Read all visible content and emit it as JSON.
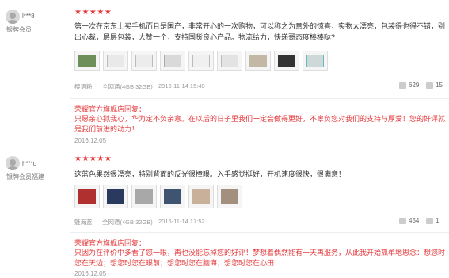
{
  "reviews": [
    {
      "username": "l***8",
      "level": "银牌会员",
      "stars": "★★★★★",
      "content": "第一次在京东上买手机而且是国产，非常开心的一次购物，可以称之为意外的惊喜，实物太漂亮，包装得也得不错，别出心裁，层层包装，大赞一个，支持国货良心产品。物流给力，快递哥态度棒棒哒?",
      "color": "樱语粉",
      "spec": "全网通(4GB 32GB)",
      "datetime": "2016-11-14 15:49",
      "likes": "629",
      "replies": "15",
      "reply_label": "荣耀官方旗舰店回复：",
      "reply_text": "只愿亲心拟我心，华为定不负亲意。在以后的日子里我们一定会做得更好，不辜负您对我们的支持与厚爱！您的好评就是我们前进的动力！",
      "reply_date": "2016.12.05"
    },
    {
      "username": "h***u",
      "level": "银牌会员",
      "region": "福建",
      "stars": "★★★★★",
      "content": "这蓝色果然很漂亮，特别背面的反光很撞眼。入手感觉挺好，开机速度很快，很满意！",
      "color": "魅海蓝",
      "spec": "全网通(4GB 32GB)",
      "datetime": "2016-11-14 17:52",
      "likes": "454",
      "replies": "1",
      "reply_label": "荣耀官方旗舰店回复：",
      "reply_text": "只因为在评价中多看了您一眼，再也没能忘掉您的好评！梦想着偶然能有一天再服务，从此我开始孤单地思念：想您时您在天边；想您时您在眼前；想您时您在脑海；想您时您在心田...",
      "reply_date": "2016.12.05"
    }
  ],
  "colors": {
    "accent": "#e4393c",
    "muted": "#999999"
  }
}
